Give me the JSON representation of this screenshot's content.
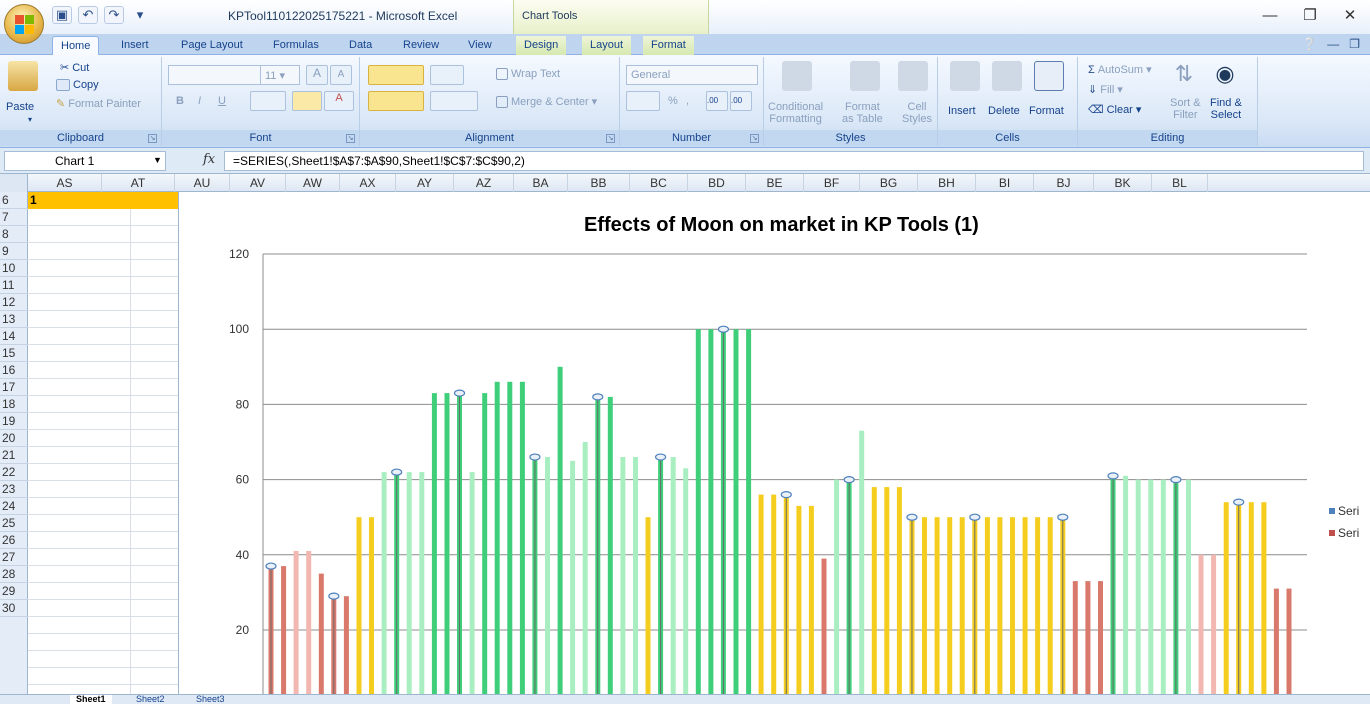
{
  "window": {
    "title": "KPTool110122025175221 - Microsoft Excel",
    "context_tab_group": "Chart Tools"
  },
  "tabs": [
    "Home",
    "Insert",
    "Page Layout",
    "Formulas",
    "Data",
    "Review",
    "View",
    "Design",
    "Layout",
    "Format"
  ],
  "ribbon": {
    "clipboard": {
      "label": "Clipboard",
      "paste": "Paste",
      "cut": "Cut",
      "copy": "Copy",
      "format_painter": "Format Painter"
    },
    "font": {
      "label": "Font",
      "size": "11",
      "bold": "B",
      "italic": "I",
      "underline": "U",
      "grow": "A",
      "shrink": "A"
    },
    "alignment": {
      "label": "Alignment",
      "wrap_text": "Wrap Text",
      "merge_center": "Merge & Center"
    },
    "number": {
      "label": "Number",
      "format": "General",
      "percent": "%",
      "comma": ",",
      "inc_decimal": ".00",
      "dec_decimal": ".00"
    },
    "styles": {
      "label": "Styles",
      "conditional": "Conditional",
      "conditional2": "Formatting",
      "format_table": "Format",
      "format_table2": "as Table",
      "cell_styles": "Cell",
      "cell_styles2": "Styles"
    },
    "cells": {
      "label": "Cells",
      "insert": "Insert",
      "delete": "Delete",
      "format": "Format"
    },
    "editing": {
      "label": "Editing",
      "autosum": "AutoSum",
      "fill": "Fill",
      "clear": "Clear",
      "sort": "Sort &",
      "sort2": "Filter",
      "find": "Find &",
      "find2": "Select"
    }
  },
  "formula_bar": {
    "name_box": "Chart 1",
    "fx": "fx",
    "formula": "=SERIES(,Sheet1!$A$7:$A$90,Sheet1!$C$7:$C$90,2)"
  },
  "columns": [
    "AS",
    "AT",
    "AU",
    "AV",
    "AW",
    "AX",
    "AY",
    "AZ",
    "BA",
    "BB",
    "BC",
    "BD",
    "BE",
    "BF",
    "BG",
    "BH",
    "BI",
    "BJ",
    "BK",
    "BL"
  ],
  "rows": [
    "6",
    "7",
    "8",
    "9",
    "10",
    "11",
    "12",
    "13",
    "14",
    "15",
    "16",
    "17",
    "18",
    "19",
    "20",
    "21",
    "22",
    "23",
    "24",
    "25",
    "26",
    "27",
    "28",
    "29",
    "30"
  ],
  "active_cell_text": "1",
  "sheet_tabs": [
    "Sheet1",
    "Sheet2",
    "Sheet3"
  ],
  "chart_data": {
    "type": "bar",
    "title": "Effects of Moon on market in KP Tools (1)",
    "xlabel": "",
    "ylabel": "",
    "ylim": [
      0,
      120
    ],
    "yticks": [
      20,
      40,
      60,
      80,
      100,
      120
    ],
    "grid": true,
    "legend": "right",
    "legend_entries": [
      "Seri",
      "Seri"
    ],
    "colors": {
      "red": "#d9796b",
      "pink": "#f2b7b1",
      "yellow": "#f5cd1e",
      "green": "#3fcf7b",
      "lightgreen": "#a9eec0",
      "marker": "#4f81bd",
      "legend_blue": "#4f81bd",
      "legend_red": "#c0504d"
    },
    "values": [
      37,
      37,
      41,
      41,
      35,
      29,
      29,
      50,
      50,
      62,
      62,
      62,
      62,
      83,
      83,
      83,
      62,
      83,
      86,
      86,
      86,
      66,
      66,
      90,
      65,
      70,
      82,
      82,
      66,
      66,
      50,
      66,
      66,
      63,
      100,
      100,
      100,
      100,
      100,
      56,
      56,
      56,
      53,
      53,
      39,
      60,
      60,
      73,
      58,
      58,
      58,
      50,
      50,
      50,
      50,
      50,
      50,
      50,
      50,
      50,
      50,
      50,
      50,
      50,
      33,
      33,
      33,
      61,
      61,
      60,
      60,
      60,
      60,
      60,
      40,
      40,
      54,
      54,
      54,
      54,
      31,
      31
    ],
    "color_keys": [
      "red",
      "red",
      "pink",
      "pink",
      "red",
      "red",
      "red",
      "yellow",
      "yellow",
      "lightgreen",
      "green",
      "lightgreen",
      "lightgreen",
      "green",
      "green",
      "green",
      "lightgreen",
      "green",
      "green",
      "green",
      "green",
      "green",
      "lightgreen",
      "green",
      "lightgreen",
      "lightgreen",
      "green",
      "green",
      "lightgreen",
      "lightgreen",
      "yellow",
      "green",
      "lightgreen",
      "lightgreen",
      "green",
      "green",
      "green",
      "green",
      "green",
      "yellow",
      "yellow",
      "yellow",
      "yellow",
      "yellow",
      "red",
      "lightgreen",
      "green",
      "lightgreen",
      "yellow",
      "yellow",
      "yellow",
      "yellow",
      "yellow",
      "yellow",
      "yellow",
      "yellow",
      "yellow",
      "yellow",
      "yellow",
      "yellow",
      "yellow",
      "yellow",
      "yellow",
      "yellow",
      "red",
      "red",
      "red",
      "green",
      "lightgreen",
      "lightgreen",
      "lightgreen",
      "lightgreen",
      "green",
      "lightgreen",
      "pink",
      "pink",
      "yellow",
      "yellow",
      "yellow",
      "yellow",
      "red",
      "red"
    ],
    "marked": [
      0,
      5,
      10,
      15,
      21,
      26,
      31,
      36,
      41,
      46,
      51,
      56,
      63,
      67,
      72,
      77
    ]
  }
}
